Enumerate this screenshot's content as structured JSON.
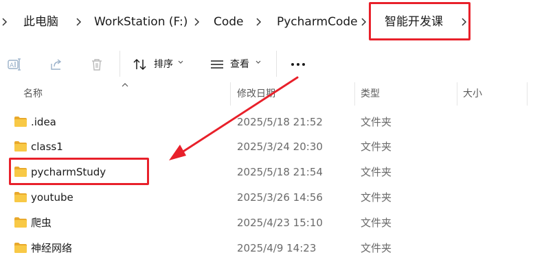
{
  "breadcrumb": {
    "items": [
      {
        "label": "此电脑"
      },
      {
        "label": "WorkStation (F:)"
      },
      {
        "label": "Code"
      },
      {
        "label": "PycharmCode"
      },
      {
        "label": "智能开发课"
      }
    ]
  },
  "toolbar": {
    "rename_icon": "rename-icon",
    "share_icon": "share-icon",
    "delete_icon": "trash-icon",
    "sort_label": "排序",
    "view_label": "查看",
    "more_label": "•••"
  },
  "columns": {
    "name": "名称",
    "modified": "修改日期",
    "type": "类型",
    "size": "大小"
  },
  "files": [
    {
      "name": ".idea",
      "modified": "2025/5/18 21:52",
      "type": "文件夹"
    },
    {
      "name": "class1",
      "modified": "2025/3/24 20:30",
      "type": "文件夹"
    },
    {
      "name": "pycharmStudy",
      "modified": "2025/5/18 21:54",
      "type": "文件夹"
    },
    {
      "name": "youtube",
      "modified": "2025/3/26 14:56",
      "type": "文件夹"
    },
    {
      "name": "爬虫",
      "modified": "2025/4/23 15:10",
      "type": "文件夹"
    },
    {
      "name": "神经网络",
      "modified": "2025/4/9 14:23",
      "type": "文件夹"
    }
  ],
  "colors": {
    "annotation": "#e8202a",
    "folder": "#f8c946",
    "folder_dark": "#e9a92b"
  }
}
